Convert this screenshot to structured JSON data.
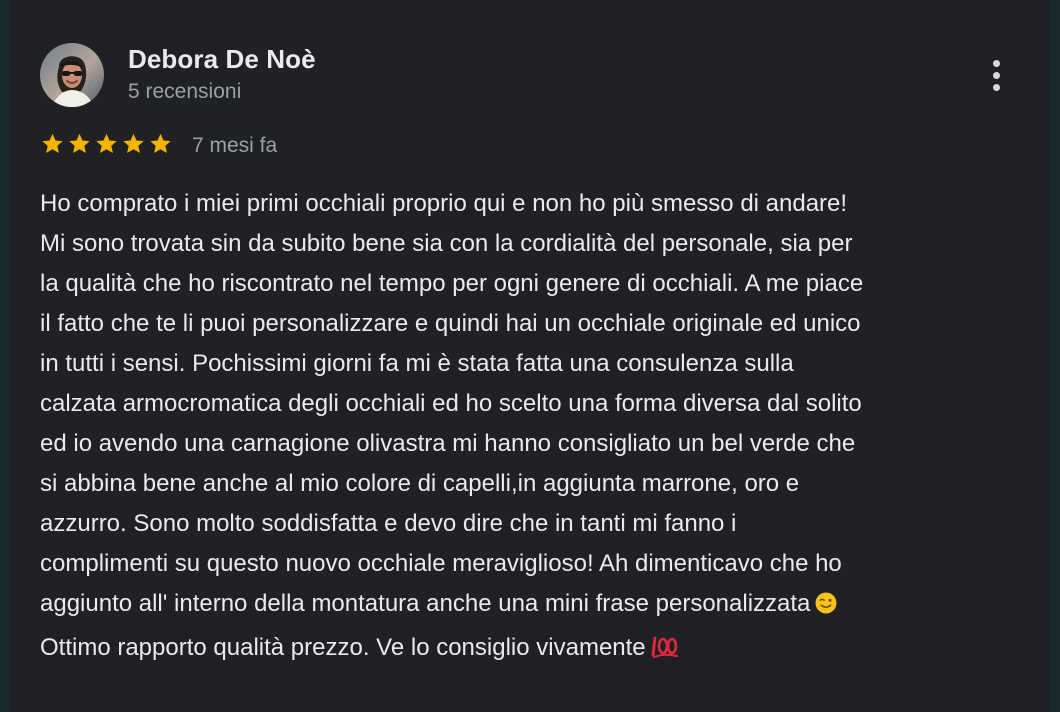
{
  "review": {
    "author": "Debora De Noè",
    "reviews_count": "5 recensioni",
    "rating": 5,
    "rating_max": 5,
    "time_ago": "7 mesi fa",
    "text_main": "Ho comprato i miei primi occhiali proprio qui e non ho più smesso di andare!\nMi sono trovata sin da subito bene sia con la cordialità del personale, sia per\nla qualità che ho riscontrato nel tempo per ogni genere di occhiali. A me piace\nil fatto che te li puoi personalizzare e quindi hai un occhiale originale ed unico\nin tutti i sensi. Pochissimi giorni fa mi è stata fatta una consulenza sulla\ncalzata armocromatica degli occhiali ed ho scelto una forma diversa dal solito\ned io avendo una carnagione olivastra mi hanno consigliato un bel verde che\nsi abbina bene anche al mio colore di capelli,in aggiunta marrone, oro e\nazzurro. Sono molto soddisfatta e devo dire che in tanti mi fanno i\ncomplimenti su questo nuovo occhiale meraviglioso! Ah dimenticavo che ho\naggiunto all' interno della montatura anche una mini frase personalizzata",
    "text_end": "\nOttimo rapporto qualità prezzo. Ve lo consiglio vivamente",
    "emojis": [
      "winking-face-emoji",
      "hundred-points-emoji"
    ]
  },
  "icons": {
    "star": "star-icon",
    "more": "more-vertical-icon",
    "avatar": "avatar"
  },
  "colors": {
    "background": "#202124",
    "text": "#e8eaed",
    "secondary_text": "#9aa0a6",
    "star": "#f4b400",
    "hundred_emoji": "#e0283d",
    "wink_emoji": "#f7c21a"
  }
}
